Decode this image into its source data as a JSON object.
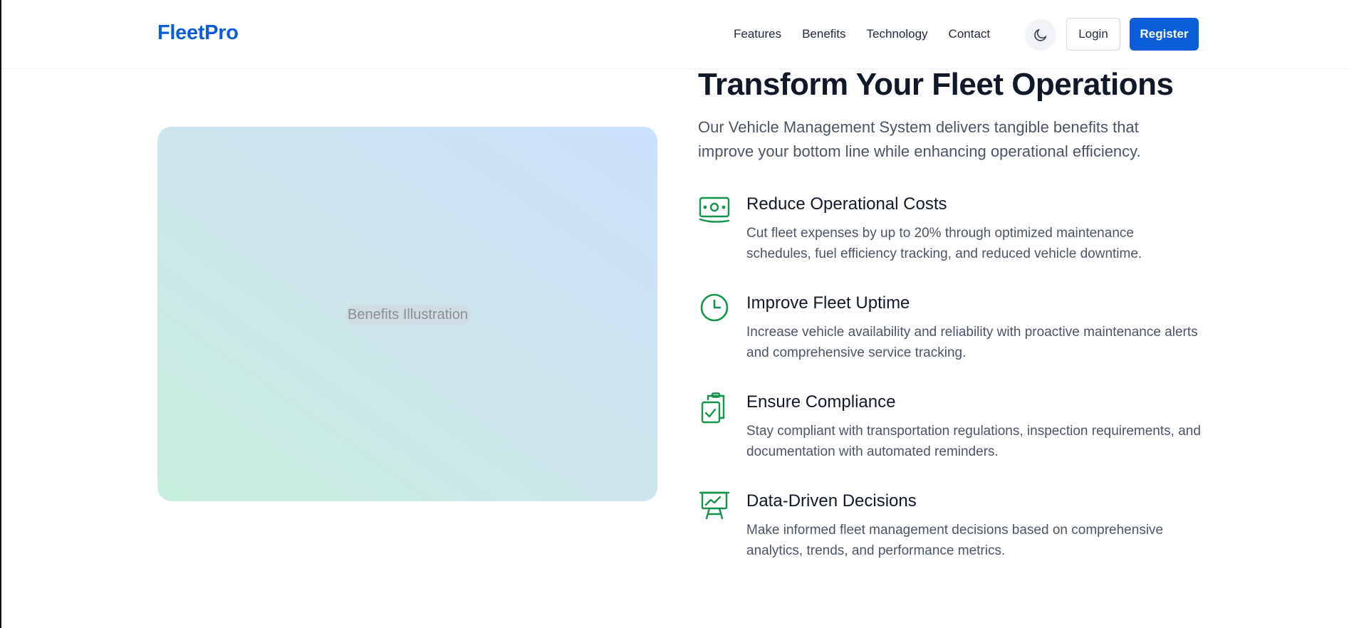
{
  "header": {
    "logo": "FleetPro",
    "nav": [
      "Features",
      "Benefits",
      "Technology",
      "Contact"
    ],
    "theme_icon": "moon-icon",
    "login_label": "Login",
    "register_label": "Register"
  },
  "illustration": {
    "label": "Benefits Illustration"
  },
  "main": {
    "title": "Transform Your Fleet Operations",
    "subtitle": "Our Vehicle Management System delivers tangible benefits that improve your bottom line while enhancing operational efficiency.",
    "benefits": [
      {
        "icon": "money-icon",
        "title": "Reduce Operational Costs",
        "description": "Cut fleet expenses by up to 20% through optimized maintenance schedules, fuel efficiency tracking, and reduced vehicle downtime."
      },
      {
        "icon": "clock-icon",
        "title": "Improve Fleet Uptime",
        "description": "Increase vehicle availability and reliability with proactive maintenance alerts and comprehensive service tracking."
      },
      {
        "icon": "clipboard-check-icon",
        "title": "Ensure Compliance",
        "description": "Stay compliant with transportation regulations, inspection requirements, and documentation with automated reminders."
      },
      {
        "icon": "presentation-chart-icon",
        "title": "Data-Driven Decisions",
        "description": "Make informed fleet management decisions based on comprehensive analytics, trends, and performance metrics."
      }
    ]
  },
  "colors": {
    "brand": "#0b5ed7",
    "icon_green": "#16934a",
    "heading": "#111827",
    "body_text": "#4b5563"
  }
}
